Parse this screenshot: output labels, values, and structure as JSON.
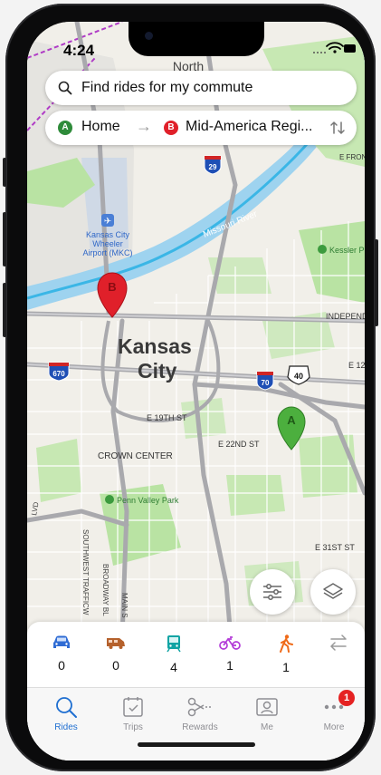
{
  "status": {
    "time": "4:24"
  },
  "search": {
    "placeholder": "Find rides for my commute"
  },
  "route": {
    "from_marker": "A",
    "from": "Home",
    "to_marker": "B",
    "to": "Mid-America Regi..."
  },
  "map": {
    "city": "Kansas City",
    "city_line1": "Kansas",
    "city_line2": "City",
    "north": "North",
    "airport_line1": "Kansas City",
    "airport_line2": "Wheeler",
    "airport_line3": "Airport (MKC)",
    "river": "Missouri River",
    "crown_center": "CROWN CENTER",
    "park": "Penn Valley Park",
    "kessler": "Kessler P",
    "e19": "E 19TH ST",
    "e22": "E 22ND ST",
    "e31": "E 31ST ST",
    "independence": "INDEPEND",
    "e12": "E 12",
    "efront": "E FRON",
    "southwest": "SOUTHWEST TRAFFICW",
    "broadway": "BROADWAY BL",
    "main": "MAIN S",
    "lvd": "LVD",
    "shield_29": "29",
    "shield_670": "670",
    "shield_70": "70",
    "shield_40": "40",
    "pin_a": "A",
    "pin_b": "B"
  },
  "modes": [
    {
      "name": "car",
      "count": "0",
      "color": "#2f6cd4"
    },
    {
      "name": "van",
      "count": "0",
      "color": "#b5612c"
    },
    {
      "name": "transit",
      "count": "4",
      "color": "#10a4a4"
    },
    {
      "name": "bike",
      "count": "1",
      "color": "#b23ad8"
    },
    {
      "name": "walk",
      "count": "1",
      "color": "#ef6a18"
    },
    {
      "name": "transfer",
      "count": "",
      "color": "#9a9a9a"
    }
  ],
  "tabs": [
    {
      "label": "Rides",
      "active": true
    },
    {
      "label": "Trips"
    },
    {
      "label": "Rewards"
    },
    {
      "label": "Me"
    },
    {
      "label": "More",
      "badge": "1"
    }
  ],
  "colors": {
    "accent": "#1f6fd1",
    "pin_a": "#4caf3e",
    "pin_b": "#e0202a",
    "park": "#b9e3a3",
    "water": "#9ed3ef",
    "river": "#3ab6e6"
  }
}
